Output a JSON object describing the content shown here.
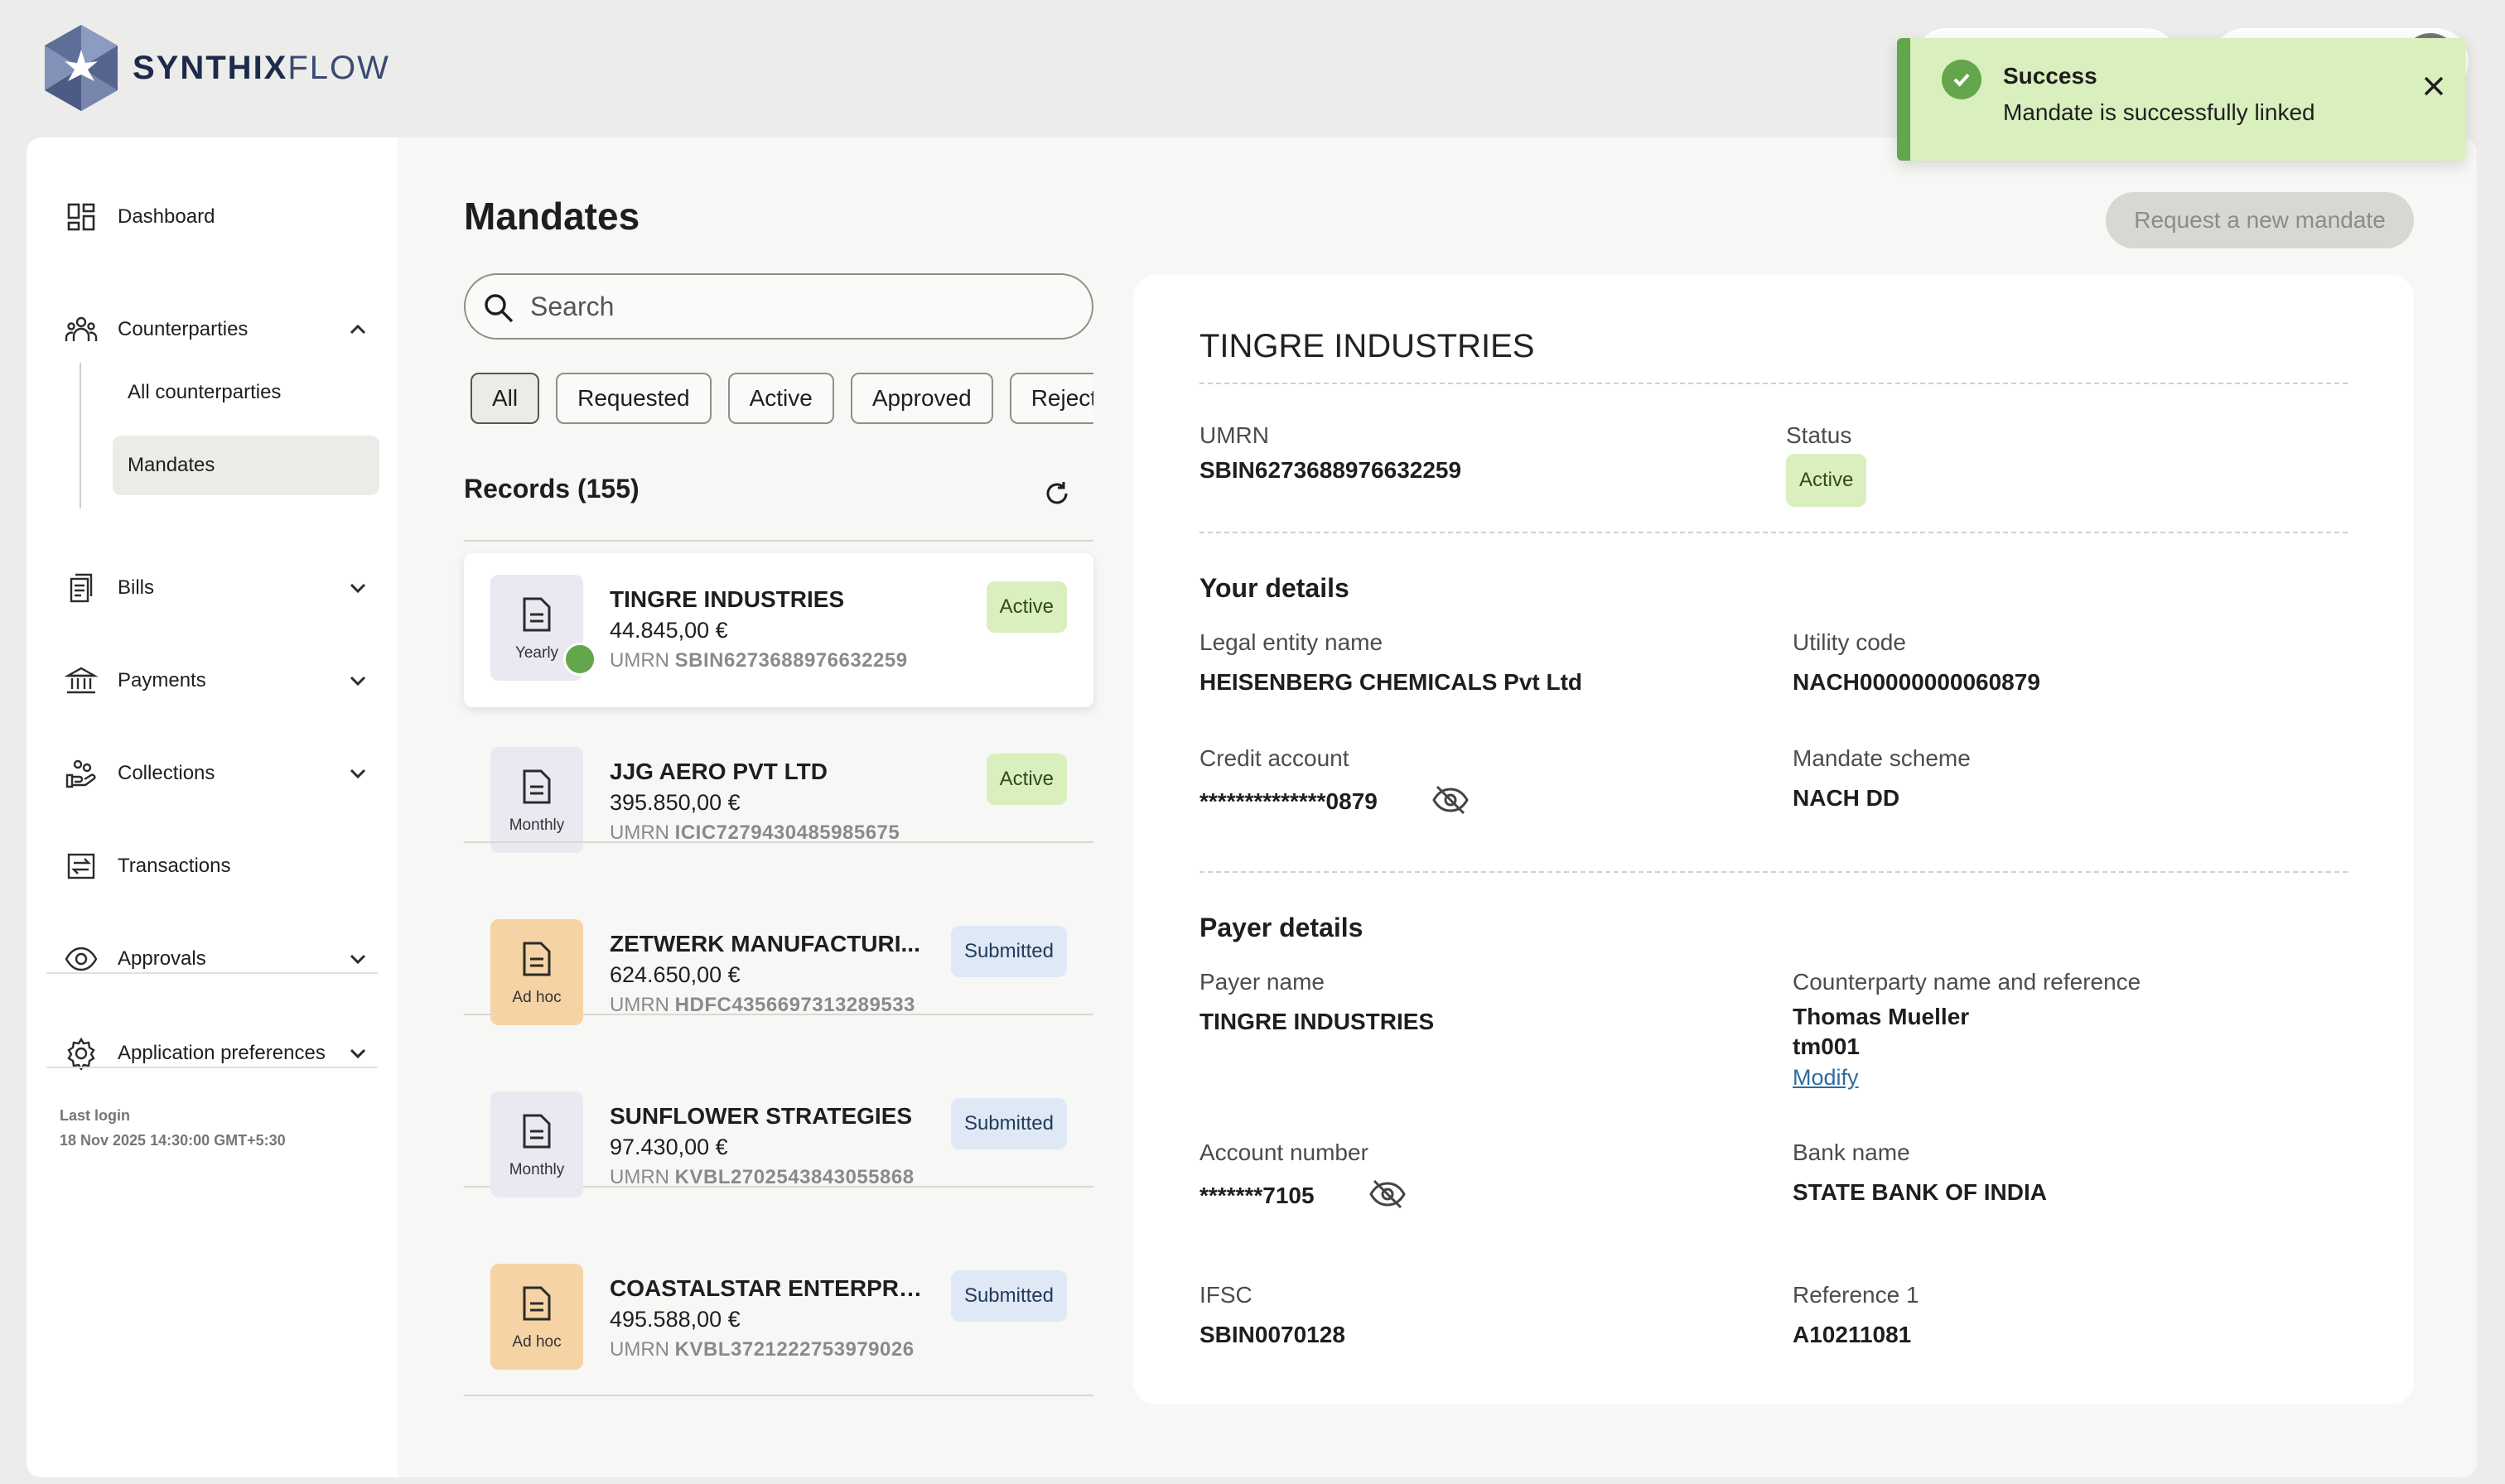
{
  "brand": {
    "name_bold": "SYNTHIX",
    "name_light": "FLOW"
  },
  "toast": {
    "title": "Success",
    "message": "Mandate is successfully linked"
  },
  "sidebar": {
    "dashboard": "Dashboard",
    "counterparties": "Counterparties",
    "all_counterparties": "All counterparties",
    "mandates": "Mandates",
    "bills": "Bills",
    "payments": "Payments",
    "collections": "Collections",
    "transactions": "Transactions",
    "approvals": "Approvals",
    "preferences": "Application preferences",
    "last_login_label": "Last login",
    "last_login_value": "18 Nov 2025 14:30:00 GMT+5:30"
  },
  "main": {
    "title": "Mandates",
    "search_placeholder": "Search",
    "request_button": "Request a new mandate",
    "filters": [
      "All",
      "Requested",
      "Active",
      "Approved",
      "Rejected"
    ],
    "records_title": "Records (155)"
  },
  "records": [
    {
      "name": "TINGRE INDUSTRIES",
      "amount": "44.845,00 €",
      "umrn_label": "UMRN",
      "umrn": "SBIN6273688976632259",
      "frequency": "Yearly",
      "status": "Active"
    },
    {
      "name": "JJG AERO PVT LTD",
      "amount": "395.850,00 €",
      "umrn_label": "UMRN",
      "umrn": "ICIC7279430485985675",
      "frequency": "Monthly",
      "status": "Active"
    },
    {
      "name": "ZETWERK MANUFACTURI...",
      "amount": "624.650,00 €",
      "umrn_label": "UMRN",
      "umrn": "HDFC4356697313289533",
      "frequency": "Ad hoc",
      "status": "Submitted"
    },
    {
      "name": "SUNFLOWER STRATEGIES",
      "amount": "97.430,00 €",
      "umrn_label": "UMRN",
      "umrn": "KVBL2702543843055868",
      "frequency": "Monthly",
      "status": "Submitted"
    },
    {
      "name": "COASTALSTAR ENTERPRI...",
      "amount": "495.588,00 €",
      "umrn_label": "UMRN",
      "umrn": "KVBL3721222753979026",
      "frequency": "Ad hoc",
      "status": "Submitted"
    }
  ],
  "detail": {
    "title": "TINGRE INDUSTRIES",
    "umrn_label": "UMRN",
    "umrn": "SBIN6273688976632259",
    "status_label": "Status",
    "status": "Active",
    "your_details_title": "Your details",
    "legal_entity_label": "Legal entity name",
    "legal_entity": "HEISENBERG CHEMICALS Pvt Ltd",
    "utility_code_label": "Utility code",
    "utility_code": "NACH00000000060879",
    "credit_account_label": "Credit account",
    "credit_account": "**************0879",
    "scheme_label": "Mandate scheme",
    "scheme": "NACH DD",
    "payer_details_title": "Payer details",
    "payer_name_label": "Payer name",
    "payer_name": "TINGRE INDUSTRIES",
    "cp_label": "Counterparty name and reference",
    "cp_name": "Thomas Mueller",
    "cp_ref": "tm001",
    "modify": "Modify",
    "account_label": "Account number",
    "account": "*******7105",
    "bank_label": "Bank name",
    "bank": "STATE BANK OF INDIA",
    "ifsc_label": "IFSC",
    "ifsc": "SBIN0070128",
    "ref1_label": "Reference 1",
    "ref1": "A10211081"
  },
  "colors": {
    "accent_green": "#63a64b",
    "active_bg": "#d9efbd",
    "submitted_bg": "#dfe9f6",
    "adhoc_bg": "#f6d3a4"
  }
}
